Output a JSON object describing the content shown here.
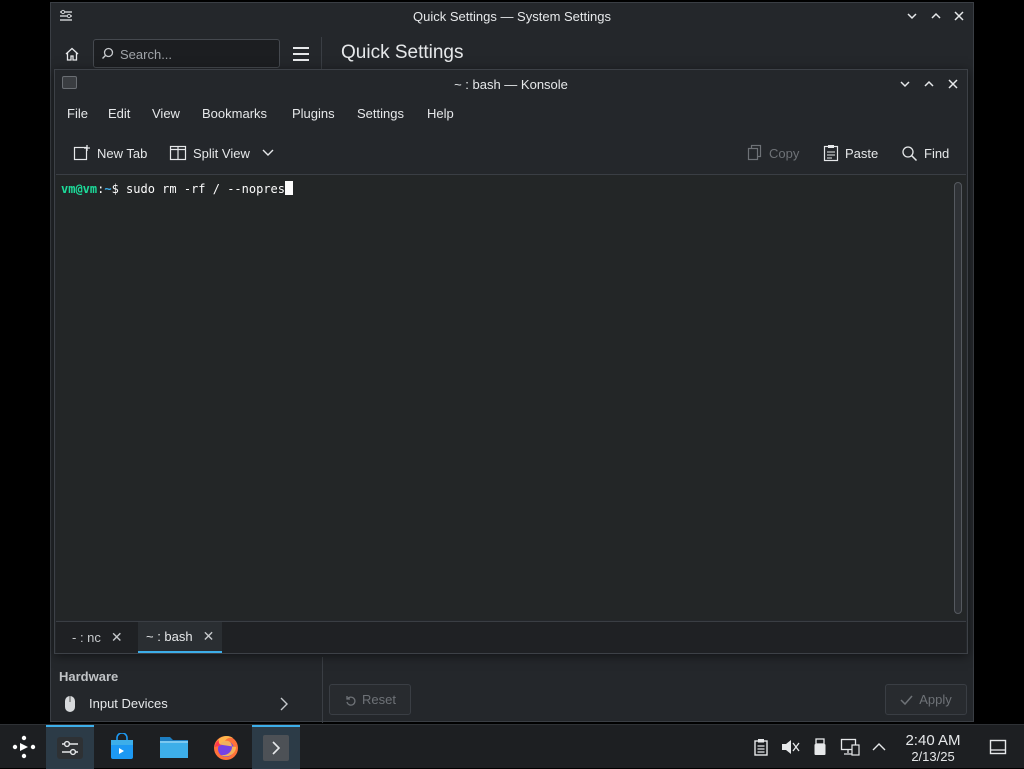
{
  "system_settings": {
    "window_title": "Quick Settings — System Settings",
    "search_placeholder": "Search...",
    "page_heading": "Quick Settings",
    "sidebar_section": "Hardware",
    "sidebar_item": "Input Devices",
    "reset_label": "Reset",
    "apply_label": "Apply"
  },
  "konsole": {
    "window_title": "~ : bash — Konsole",
    "menu": [
      "File",
      "Edit",
      "View",
      "Bookmarks",
      "Plugins",
      "Settings",
      "Help"
    ],
    "toolbar": {
      "new_tab": "New Tab",
      "split_view": "Split View",
      "copy": "Copy",
      "paste": "Paste",
      "find": "Find"
    },
    "terminal": {
      "user_host": "vm@vm",
      "colon": ":",
      "path": "~",
      "dollar": "$",
      "command": " sudo rm -rf / --nopres"
    },
    "tabs": [
      {
        "label": "- : nc",
        "active": false
      },
      {
        "label": "~ : bash",
        "active": true
      }
    ]
  },
  "taskbar": {
    "clock_time": "2:40 AM",
    "clock_date": "2/13/25",
    "apps": [
      "app-launcher",
      "system-settings",
      "discover",
      "dolphin",
      "firefox",
      "konsole"
    ]
  },
  "colors": {
    "accent": "#3daee9",
    "prompt_user": "#1cdc9a",
    "window_bg": "#24272b",
    "terminal_bg": "#232627"
  }
}
